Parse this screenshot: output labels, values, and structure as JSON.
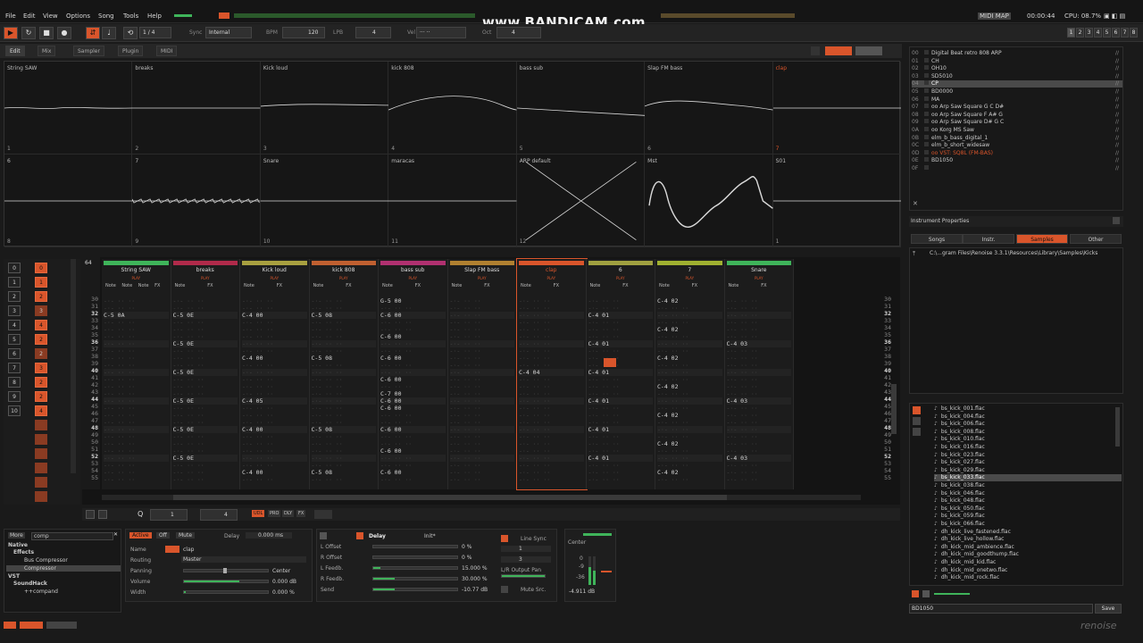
{
  "menu": [
    "File",
    "Edit",
    "View",
    "Options",
    "Song",
    "Tools",
    "Help"
  ],
  "watermark": "www.BANDICAM.com",
  "status_right": {
    "midi": "MIDI MAP",
    "time": "00:00:44",
    "cpu": "CPU: 08.7%"
  },
  "transport": {
    "step": "1 / 4",
    "sync_label": "Sync",
    "sync_value": "Internal",
    "bpm_label": "BPM",
    "bpm": "120",
    "lpb_label": "LPB",
    "lpb": "4",
    "vel_label": "Vel",
    "oct_label": "Oct",
    "oct": "4",
    "numpad": [
      "1",
      "2",
      "3",
      "4",
      "5",
      "6",
      "7",
      "8"
    ]
  },
  "subtabs": [
    "Edit",
    "Mix",
    "Sampler",
    "Plugin",
    "MIDI"
  ],
  "waveforms": [
    {
      "name": "String SAW",
      "num": "1"
    },
    {
      "name": "breaks",
      "num": "2"
    },
    {
      "name": "Kick loud",
      "num": "3"
    },
    {
      "name": "kick 808",
      "num": "4"
    },
    {
      "name": "bass sub",
      "num": "5"
    },
    {
      "name": "Slap FM bass",
      "num": "6"
    },
    {
      "name": "clap",
      "num": "7"
    },
    {
      "name": "6",
      "num": "8"
    },
    {
      "name": "7",
      "num": "9"
    },
    {
      "name": "Snare",
      "num": "10"
    },
    {
      "name": "maracas",
      "num": "11"
    },
    {
      "name": "ARP default",
      "num": "12"
    },
    {
      "name": "Mst",
      "num": ""
    },
    {
      "name": "S01",
      "num": "1"
    }
  ],
  "seq_slots": [
    "0",
    "1",
    "2",
    "3",
    "4",
    "5",
    "6",
    "7",
    "8",
    "9",
    "10"
  ],
  "seq_vals": [
    "0",
    "1",
    "2",
    "3",
    "4",
    "2",
    "2",
    "3",
    "2",
    "2",
    "4"
  ],
  "pattern_len": "64",
  "rownums": [
    "30",
    "31",
    "32",
    "33",
    "34",
    "35",
    "36",
    "37",
    "38",
    "39",
    "40",
    "41",
    "42",
    "43",
    "44",
    "45",
    "46",
    "47",
    "48",
    "49",
    "50",
    "51",
    "52",
    "53",
    "54",
    "55"
  ],
  "tracks": [
    {
      "name": "String SAW",
      "color": "#3fb45a",
      "cols": [
        "Note",
        "Note",
        "Note",
        "FX"
      ],
      "notes": {
        "32": "C-5 0A"
      }
    },
    {
      "name": "breaks",
      "color": "#b02a4a",
      "cols": [
        "Note",
        "FX"
      ],
      "notes": {
        "32": "C-5 0E",
        "36": "C-5 0E",
        "40": "C-5 0E",
        "44": "C-5 0E",
        "48": "C-5 0E",
        "52": "C-5 0E"
      }
    },
    {
      "name": "Kick loud",
      "color": "#a8a040",
      "cols": [
        "Note",
        "FX"
      ],
      "notes": {
        "32": "C-4 00",
        "38": "C-4 00",
        "44": "C-4 05",
        "48": "C-4 00",
        "54": "C-4 00"
      }
    },
    {
      "name": "kick 808",
      "color": "#c06030",
      "cols": [
        "Note",
        "FX"
      ],
      "notes": {
        "32": "C-5 08",
        "38": "C-5 08",
        "48": "C-5 08",
        "54": "C-5 08"
      }
    },
    {
      "name": "bass sub",
      "color": "#b03070",
      "cols": [
        "Note",
        "FX"
      ],
      "notes": {
        "30": "G-5 00",
        "32": "C-6 00",
        "35": "C-6 00",
        "38": "C-6 00",
        "41": "C-6 00",
        "43": "C-7 00",
        "44": "C-6 00",
        "45": "C-6 00",
        "48": "C-6 00",
        "51": "C-6 00",
        "54": "C-6 00"
      }
    },
    {
      "name": "Slap FM bass",
      "color": "#b08030",
      "cols": [
        "Note",
        "FX"
      ],
      "notes": {}
    },
    {
      "name": "clap",
      "color": "#d9552b",
      "cols": [
        "Note",
        "FX"
      ],
      "notes": {
        "40": "C-4 04"
      }
    },
    {
      "name": "6",
      "color": "#a0a040",
      "cols": [
        "Note",
        "FX"
      ],
      "notes": {
        "32": "C-4 01",
        "36": "C-4 01",
        "40": "C-4 01",
        "44": "C-4 01",
        "48": "C-4 01",
        "52": "C-4 01"
      }
    },
    {
      "name": "7",
      "color": "#a0b030",
      "cols": [
        "Note",
        "FX"
      ],
      "notes": {
        "30": "C-4 02",
        "34": "C-4 02",
        "38": "C-4 02",
        "42": "C-4 02",
        "46": "C-4 02",
        "50": "C-4 02",
        "54": "C-4 02"
      }
    },
    {
      "name": "Snare",
      "color": "#3fb45a",
      "cols": [
        "Note",
        "FX"
      ],
      "notes": {
        "36": "C-4 03",
        "44": "C-4 03",
        "52": "C-4 03"
      }
    }
  ],
  "play_label": "PLAY",
  "pattern_bottom": {
    "q": "Q",
    "q_val": "1",
    "step_val": "4",
    "btns": [
      "UDL",
      "PRO",
      "DLY",
      "FX"
    ]
  },
  "instruments": [
    {
      "n": "00",
      "name": "Digital Beat retro 808 ARP"
    },
    {
      "n": "01",
      "name": "CH"
    },
    {
      "n": "02",
      "name": "OH10"
    },
    {
      "n": "03",
      "name": "SD5010"
    },
    {
      "n": "04",
      "name": "CP"
    },
    {
      "n": "05",
      "name": "BD0000"
    },
    {
      "n": "06",
      "name": "MA"
    },
    {
      "n": "07",
      "name": "oo Arp Saw Square G C D#"
    },
    {
      "n": "08",
      "name": "oo Arp Saw Square F A# G"
    },
    {
      "n": "09",
      "name": "oo Arp Saw Square D# G C"
    },
    {
      "n": "0A",
      "name": "oo Korg MS Saw"
    },
    {
      "n": "0B",
      "name": "elm_b_bass_digital_1"
    },
    {
      "n": "0C",
      "name": "elm_b_short_widesaw"
    },
    {
      "n": "0D",
      "name": "oo VST: SQ8L (FM-BAS)"
    },
    {
      "n": "0E",
      "name": "BD1050"
    },
    {
      "n": "0F",
      "name": ""
    }
  ],
  "instrument_props": "Instrument Properties",
  "browser_tabs": [
    "Songs",
    "Instr.",
    "Samples",
    "Other"
  ],
  "browser_path": "C:\\...gram Files\\Renoise 3.3.1\\Resources\\Library\\Samples\\Kicks",
  "files": [
    "bs_kick_001.flac",
    "bs_kick_004.flac",
    "bs_kick_006.flac",
    "bs_kick_008.flac",
    "bs_kick_010.flac",
    "bs_kick_016.flac",
    "bs_kick_023.flac",
    "bs_kick_027.flac",
    "bs_kick_029.flac",
    "bs_kick_033.flac",
    "bs_kick_038.flac",
    "bs_kick_046.flac",
    "bs_kick_048.flac",
    "bs_kick_050.flac",
    "bs_kick_059.flac",
    "bs_kick_066.flac",
    "dh_kick_live_fastened.flac",
    "dh_kick_live_hollow.flac",
    "dh_kick_mid_ambience.flac",
    "dh_kick_mid_goodthump.flac",
    "dh_kick_mid_kid.flac",
    "dh_kick_mid_onetwo.flac",
    "dh_kick_mid_rock.flac"
  ],
  "file_selected": "bs_kick_033.flac",
  "filename_value": "BD1050",
  "save_label": "Save",
  "dsp": {
    "more": "More",
    "search": "comp",
    "native": "Native",
    "effects": "Effects",
    "bus": "Bus Compressor",
    "comp": "Compressor",
    "vst": "VST",
    "soundhack": "SoundHack",
    "plugin": "++compand"
  },
  "trackdsp": {
    "active": "Active",
    "off": "Off",
    "mute": "Mute",
    "delay_label": "Delay",
    "delay_val": "0.000 ms",
    "name_label": "Name",
    "name_val": "clap",
    "routing_label": "Routing",
    "routing_val": "Master",
    "panning_label": "Panning",
    "panning_val": "Center",
    "volume_label": "Volume",
    "volume_val": "0.000 dB",
    "width_label": "Width",
    "width_val": "0.000 %"
  },
  "delay": {
    "title": "Delay",
    "preset": "Init*",
    "rows": [
      {
        "label": "L Offset",
        "val": "0 %"
      },
      {
        "label": "R Offset",
        "val": "0 %"
      },
      {
        "label": "L Feedb.",
        "val": "15.000 %"
      },
      {
        "label": "R Feedb.",
        "val": "30.000 %"
      },
      {
        "label": "Send",
        "val": "-10.77 dB"
      }
    ],
    "line_sync": "Line Sync",
    "l_val": "1",
    "r_val": "3",
    "lr_pan": "L/R Output Pan",
    "mute_src": "Mute Src."
  },
  "meter": {
    "center": "Center",
    "db_top": "0",
    "db_mid": "-9",
    "db_low": "-36",
    "db_val": "-4.911 dB"
  },
  "logo": "renoise"
}
